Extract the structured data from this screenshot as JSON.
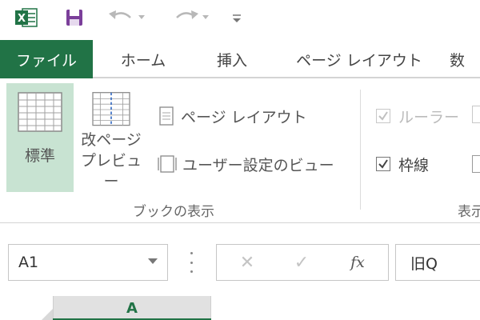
{
  "qat": {
    "app_icon": "excel-icon",
    "save_icon": "save-icon",
    "undo_icon": "undo-icon",
    "redo_icon": "redo-icon",
    "customize_icon": "customize-dropdown-icon"
  },
  "tabs": [
    {
      "label": "ファイル",
      "active": true
    },
    {
      "label": "ホーム"
    },
    {
      "label": "挿入"
    },
    {
      "label": "ページ レイアウト"
    },
    {
      "label": "数"
    }
  ],
  "ribbon": {
    "workbook_view": {
      "normal_label": "標準",
      "page_break_label_1": "改ページ",
      "page_break_label_2": "プレビュー",
      "page_layout_label": "ページ レイアウト",
      "custom_view_label": "ユーザー設定のビュー",
      "group_label": "ブックの表示"
    },
    "show": {
      "ruler_label": "ルーラー",
      "gridlines_label": "枠線",
      "group_label": "表示"
    }
  },
  "formula_bar": {
    "name_box_value": "A1",
    "cancel_symbol": "✕",
    "enter_symbol": "✓",
    "fx_label": "fx",
    "formula_value": "旧Q"
  },
  "columns": {
    "a_label": "A"
  },
  "colors": {
    "accent": "#217346",
    "selected_bg": "#c8e3d2",
    "save_purple": "#7b3f9a"
  }
}
